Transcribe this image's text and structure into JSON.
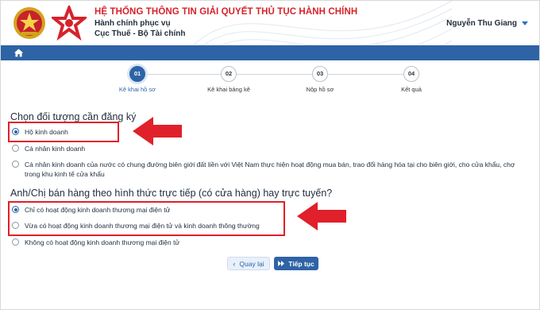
{
  "header": {
    "system_title": "HỆ THỐNG THÔNG TIN GIẢI QUYẾT THỦ TỤC HÀNH CHÍNH",
    "org_line1": "Hành chính phục vụ",
    "org_line2": "Cục Thuế - Bộ Tài chính",
    "user_name": "Nguyễn Thu Giang"
  },
  "navbar": {
    "home_icon": "home-icon",
    "color": "#2e63a6"
  },
  "steps": [
    {
      "number": "01",
      "label": "Kê khai hồ sơ",
      "active": true
    },
    {
      "number": "02",
      "label": "Kê khai bảng kê",
      "active": false
    },
    {
      "number": "03",
      "label": "Nộp hồ sơ",
      "active": false
    },
    {
      "number": "04",
      "label": "Kết quả",
      "active": false
    }
  ],
  "question1": {
    "title": "Chọn đối tượng cần đăng ký",
    "options": [
      {
        "label": "Hộ kinh doanh",
        "checked": true
      },
      {
        "label": "Cá nhân kinh doanh",
        "checked": false
      },
      {
        "label": "Cá nhân kinh doanh của nước có chung đường biên giới đất liền với Việt Nam thực hiện hoạt động mua bán, trao đổi hàng hóa tại cho biên giới, cho cửa khẩu, chợ trong khu kinh tế cửa khẩu",
        "checked": false
      }
    ]
  },
  "question2": {
    "title": "Anh/Chị bán hàng theo hình thức trực tiếp (có cửa hàng) hay trực tuyến?",
    "options": [
      {
        "label": "Chỉ có hoạt động kinh doanh thương mại điện tử",
        "checked": true
      },
      {
        "label": "Vừa có hoạt động kinh doanh thương mại điện tử và kinh doanh thông thường",
        "checked": false
      },
      {
        "label": "Không có hoạt động kinh doanh thương mại điện tử",
        "checked": false
      }
    ]
  },
  "buttons": {
    "back": "Quay lại",
    "next": "Tiếp tục"
  },
  "colors": {
    "primary": "#2e63a6",
    "title_red": "#d6232b",
    "highlight": "#e0202a"
  }
}
